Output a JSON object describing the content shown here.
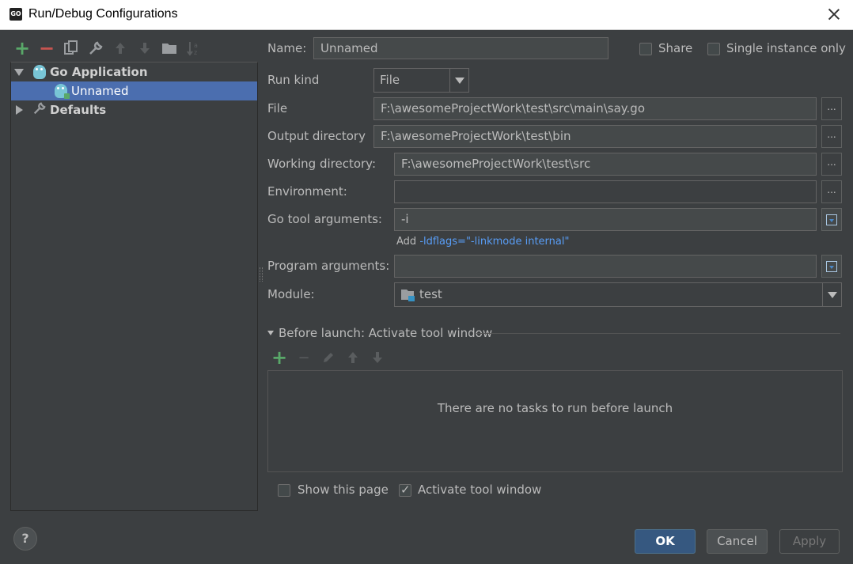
{
  "window": {
    "title": "Run/Debug Configurations",
    "app_icon_text": "GO"
  },
  "toolbar": {
    "add": "+",
    "remove": "−"
  },
  "tree": {
    "group_label": "Go Application",
    "child_label": "Unnamed",
    "defaults_label": "Defaults"
  },
  "form": {
    "name_label": "Name:",
    "name_value": "Unnamed",
    "share_label": "Share",
    "single_instance_label": "Single instance only",
    "run_kind_label": "Run kind",
    "run_kind_value": "File",
    "file_label": "File",
    "file_value": "F:\\awesomeProjectWork\\test\\src\\main\\say.go",
    "output_dir_label": "Output directory",
    "output_dir_value": "F:\\awesomeProjectWork\\test\\bin",
    "working_dir_label": "Working directory:",
    "working_dir_value": "F:\\awesomeProjectWork\\test\\src",
    "environment_label": "Environment:",
    "environment_value": "",
    "go_tool_args_label": "Go tool arguments:",
    "go_tool_args_value": "-i",
    "hint_prefix": "Add ",
    "hint_link": "-ldflags=\"-linkmode internal\"",
    "program_args_label": "Program arguments:",
    "program_args_value": "",
    "module_label": "Module:",
    "module_value": "test",
    "browse_label": "..."
  },
  "before_launch": {
    "title": "Before launch: Activate tool window",
    "empty_text": "There are no tasks to run before launch",
    "show_page_label": "Show this page",
    "activate_tool_label": "Activate tool window"
  },
  "buttons": {
    "ok": "OK",
    "cancel": "Cancel",
    "apply": "Apply",
    "help": "?"
  }
}
